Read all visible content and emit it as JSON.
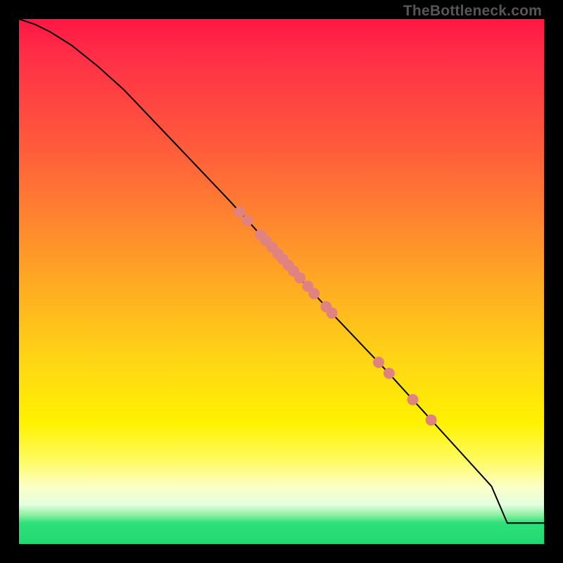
{
  "watermark": "TheBottleneck.com",
  "chart_data": {
    "type": "line",
    "title": "",
    "xlabel": "",
    "ylabel": "",
    "xlim": [
      0,
      100
    ],
    "ylim": [
      0,
      100
    ],
    "grid": false,
    "legend": false,
    "series": [
      {
        "name": "curve",
        "x": [
          0,
          3,
          6,
          10,
          15,
          20,
          30,
          40,
          50,
          60,
          70,
          80,
          90,
          93,
          100
        ],
        "y": [
          100,
          99,
          97.5,
          95,
          91,
          86.5,
          76,
          65.5,
          54.5,
          43.5,
          33,
          22,
          11,
          4,
          4
        ]
      }
    ],
    "points": [
      {
        "x": 42.0,
        "y": 63.2
      },
      {
        "x": 43.5,
        "y": 61.6
      },
      {
        "x": 46.0,
        "y": 58.9
      },
      {
        "x": 47.0,
        "y": 57.8
      },
      {
        "x": 48.2,
        "y": 56.5
      },
      {
        "x": 49.3,
        "y": 55.3
      },
      {
        "x": 50.2,
        "y": 54.3
      },
      {
        "x": 51.3,
        "y": 53.1
      },
      {
        "x": 52.3,
        "y": 52.0
      },
      {
        "x": 53.5,
        "y": 50.7
      },
      {
        "x": 55.0,
        "y": 49.1
      },
      {
        "x": 56.2,
        "y": 47.7
      },
      {
        "x": 58.5,
        "y": 45.2
      },
      {
        "x": 59.6,
        "y": 44.0
      },
      {
        "x": 68.5,
        "y": 34.6
      },
      {
        "x": 70.5,
        "y": 32.5
      },
      {
        "x": 75.0,
        "y": 27.5
      },
      {
        "x": 78.5,
        "y": 23.6
      }
    ],
    "point_radius": 8
  }
}
